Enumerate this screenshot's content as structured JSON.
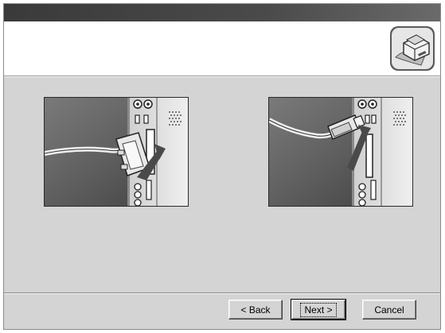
{
  "window": {
    "title": ""
  },
  "header": {
    "icon": "printer-setup-icon"
  },
  "content": {
    "figures": [
      {
        "icon": "parallel-cable-connection-illustration"
      },
      {
        "icon": "usb-cable-connection-illustration"
      }
    ]
  },
  "buttons": {
    "back_label": "< Back",
    "next_label": "Next >",
    "cancel_label": "Cancel"
  }
}
